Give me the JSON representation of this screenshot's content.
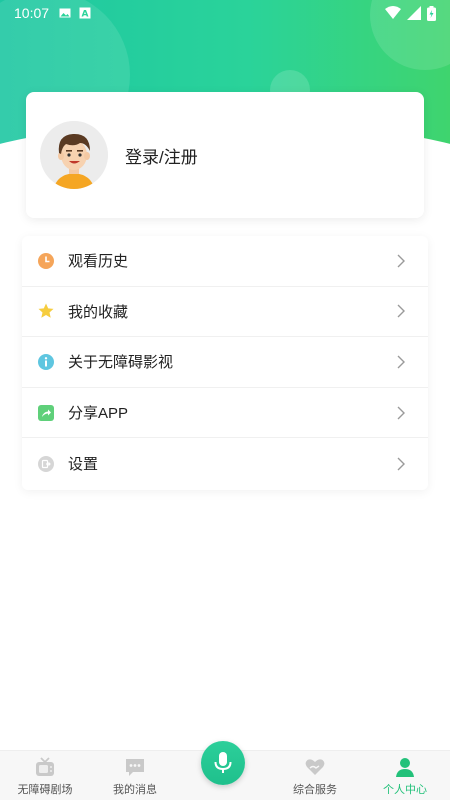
{
  "status_bar": {
    "time": "10:07"
  },
  "profile": {
    "login_label": "登录/注册"
  },
  "menu": [
    {
      "label": "观看历史",
      "icon": "clock-icon",
      "color": "#f5a55a"
    },
    {
      "label": "我的收藏",
      "icon": "star-icon",
      "color": "#f6cd3f"
    },
    {
      "label": "关于无障碍影视",
      "icon": "info-icon",
      "color": "#5fc6e0"
    },
    {
      "label": "分享APP",
      "icon": "share-icon",
      "color": "#5fd07a"
    },
    {
      "label": "设置",
      "icon": "settings-icon",
      "color": "#cfcfcf"
    }
  ],
  "bottom_nav": [
    {
      "label": "无障碍剧场",
      "icon": "tv-icon"
    },
    {
      "label": "我的消息",
      "icon": "message-icon"
    },
    {
      "label": "综合服务",
      "icon": "heart-hand-icon"
    },
    {
      "label": "个人中心",
      "icon": "person-icon",
      "active": true
    }
  ],
  "colors": {
    "accent": "#23c17a",
    "header_start": "#1ec7a2",
    "header_end": "#3fd46e"
  }
}
